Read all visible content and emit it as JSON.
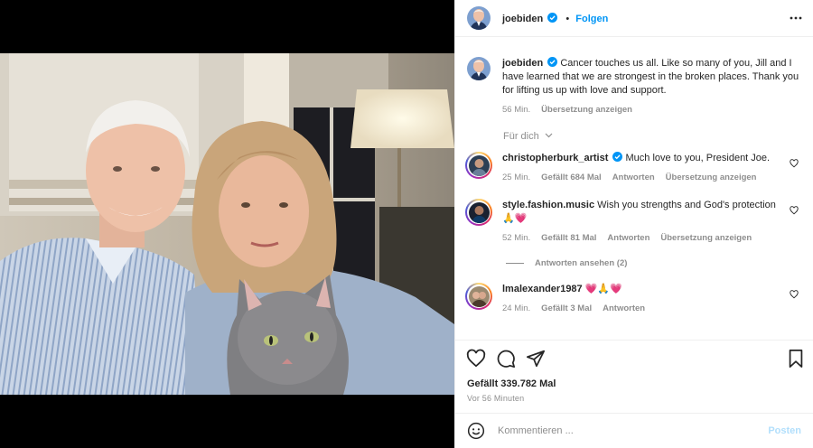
{
  "post": {
    "author": "joebiden",
    "follow_label": "Folgen",
    "more_label": "Weitere Optionen",
    "caption_user": "joebiden",
    "caption_text": "Cancer touches us all. Like so many of you, Jill and I have learned that we are strongest in the broken places. Thank you for lifting us up with love and support.",
    "caption_time": "56 Min.",
    "caption_translate": "Übersetzung anzeigen",
    "for_you_label": "Für dich",
    "likes": "Gefällt 339.782 Mal",
    "posted_ago": "Vor 56 Minuten"
  },
  "comments": [
    {
      "user": "christopherburk_artist",
      "text": "Much love to you, President Joe.",
      "time": "25 Min.",
      "likes": "Gefällt 684 Mal",
      "reply": "Antworten",
      "translate": "Übersetzung anzeigen"
    },
    {
      "user": "style.fashion.music",
      "text": "Wish you strengths and God's protection",
      "emoji": "🙏💗",
      "time": "52 Min.",
      "likes": "Gefällt 81 Mal",
      "reply": "Antworten",
      "translate": "Übersetzung anzeigen",
      "view_replies": "Antworten ansehen (2)"
    },
    {
      "user": "lmalexander1987",
      "emoji": "💗🙏💗",
      "time": "24 Min.",
      "likes": "Gefällt 3 Mal",
      "reply": "Antworten"
    }
  ],
  "composer": {
    "placeholder": "Kommentieren ...",
    "post_label": "Posten"
  },
  "icons": {
    "like": "heart-icon",
    "comment": "comment-icon",
    "share": "send-icon",
    "save": "bookmark-icon",
    "emoji": "smiley-icon",
    "verified": "verified-badge-icon"
  },
  "colors": {
    "link": "#0095f6",
    "muted": "#8e8e8e",
    "text": "#262626",
    "verified": "#0095f6"
  }
}
